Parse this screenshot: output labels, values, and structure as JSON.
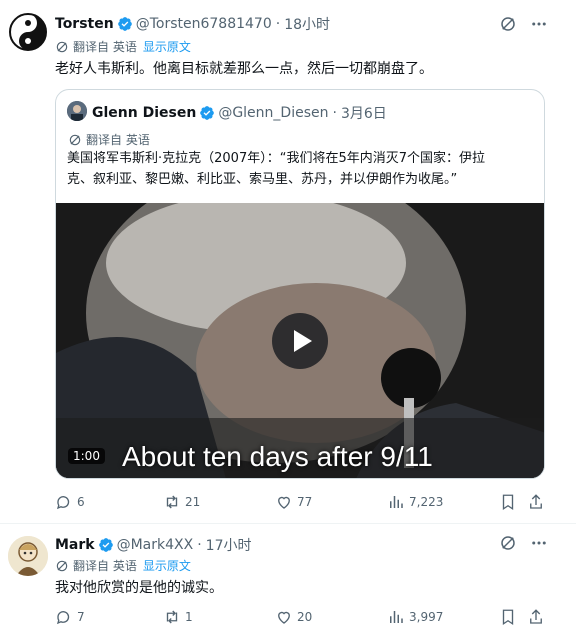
{
  "tweet1": {
    "name": "Torsten",
    "handle": "@Torsten67881470",
    "time": "18小时",
    "translated_from": "翻译自 英语",
    "show_original": "显示原文",
    "text": "老好人韦斯利。他离目标就差那么一点，然后一切都崩盘了。",
    "quote": {
      "name": "Glenn Diesen",
      "handle": "@Glenn_Diesen",
      "date": "3月6日",
      "translated_from": "翻译自 英语",
      "text_line1": "美国将军韦斯利·克拉克（2007年）：“我们将在5年内消灭7个国家：伊拉",
      "text_line2": "克、叙利亚、黎巴嫩、利比亚、索马里、苏丹，并以伊朗作为收尾。”",
      "video": {
        "duration": "1:00",
        "caption": "About ten days after 9/11"
      }
    },
    "stats": {
      "replies": "6",
      "reposts": "21",
      "likes": "77",
      "views": "7,223"
    }
  },
  "tweet2": {
    "name": "Mark",
    "handle": "@Mark4XX",
    "time": "17小时",
    "translated_from": "翻译自 英语",
    "show_original": "显示原文",
    "text": "我对他欣赏的是他的诚实。",
    "stats": {
      "replies": "7",
      "reposts": "1",
      "likes": "20",
      "views": "3,997"
    }
  },
  "colors": {
    "accent": "#1d9bf0",
    "secondary_text": "#536471",
    "border": "#cfd9de"
  }
}
